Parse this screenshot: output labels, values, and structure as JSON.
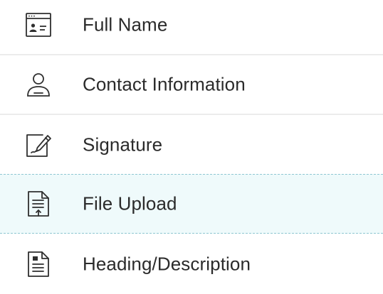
{
  "fields": [
    {
      "label": "Full Name",
      "icon": "id-card-icon"
    },
    {
      "label": "Contact Information",
      "icon": "person-icon"
    },
    {
      "label": "Signature",
      "icon": "signature-pen-icon"
    },
    {
      "label": "File Upload",
      "icon": "file-upload-icon",
      "highlighted": true
    },
    {
      "label": "Heading/Description",
      "icon": "document-heading-icon"
    }
  ],
  "colors": {
    "text": "#2b2b2b",
    "icon_stroke": "#2f2f2f",
    "divider": "#ececec",
    "highlight_bg": "#effafb",
    "highlight_border": "#8fc7d2"
  }
}
